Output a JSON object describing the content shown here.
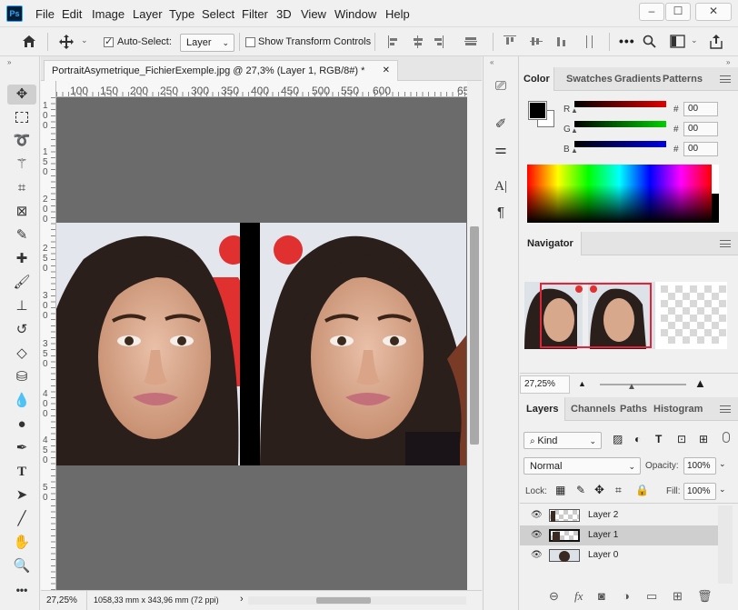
{
  "app": {
    "logo": "Ps"
  },
  "menubar": {
    "items": [
      "File",
      "Edit",
      "Image",
      "Layer",
      "Type",
      "Select",
      "Filter",
      "3D",
      "View",
      "Window",
      "Help"
    ]
  },
  "window_controls": {
    "minimize": "‒",
    "maximize": "☐",
    "close": "✕"
  },
  "options_bar": {
    "auto_select_label": "Auto-Select:",
    "auto_select_checked": true,
    "auto_select_target": "Layer",
    "show_transform_label": "Show Transform Controls",
    "show_transform_checked": false
  },
  "document": {
    "tab_title": "PortraitAsymetrique_FichierExemple.jpg @ 27,3% (Layer 1, RGB/8#) *",
    "ruler_top": [
      "100",
      "150",
      "200",
      "250",
      "300",
      "350",
      "400",
      "450",
      "500",
      "550",
      "600",
      "65"
    ],
    "ruler_left": [
      "1",
      "0",
      "0",
      "1",
      "5",
      "0",
      "2",
      "0",
      "0",
      "2",
      "5",
      "0",
      "3",
      "0",
      "0",
      "3",
      "5",
      "0",
      "4",
      "0",
      "0",
      "4",
      "5",
      "0",
      "5",
      "0"
    ]
  },
  "status_bar": {
    "zoom": "27,25%",
    "doc_size": "1058,33 mm x 343,96 mm (72 ppi)"
  },
  "color_panel": {
    "tabs": [
      "Color",
      "Swatches",
      "Gradients",
      "Patterns"
    ],
    "active_tab": "Color",
    "foreground": "#000000",
    "background": "#ffffff",
    "channels": [
      {
        "label": "R",
        "value": "00",
        "color": "#e00000"
      },
      {
        "label": "G",
        "value": "00",
        "color": "#00d000"
      },
      {
        "label": "B",
        "value": "00",
        "color": "#0000e0"
      }
    ],
    "hash": "#"
  },
  "navigator_panel": {
    "title": "Navigator",
    "zoom": "27,25%"
  },
  "layers_panel": {
    "tabs": [
      "Layers",
      "Channels",
      "Paths",
      "Histogram"
    ],
    "active_tab": "Layers",
    "filter_kind": "Kind",
    "blend_mode": "Normal",
    "opacity_label": "Opacity:",
    "opacity_value": "100%",
    "lock_label": "Lock:",
    "fill_label": "Fill:",
    "fill_value": "100%",
    "layers": [
      {
        "name": "Layer 2",
        "selected": false
      },
      {
        "name": "Layer 1",
        "selected": true
      },
      {
        "name": "Layer 0",
        "selected": false
      }
    ],
    "bottom_icons": [
      "link-icon",
      "fx-icon",
      "mask-icon",
      "adjustment-icon",
      "folder-icon",
      "new-layer-icon",
      "trash-icon"
    ],
    "fx_label": "fx"
  },
  "colors": {
    "canvas_bg": "#6b6b6b",
    "selection": "#cfcfcf",
    "nav_frame": "#e0243a"
  }
}
